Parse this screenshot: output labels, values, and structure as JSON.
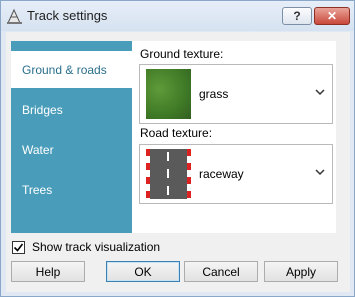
{
  "window": {
    "title": "Track settings",
    "help_button": "?",
    "close_button": "✕",
    "icon": "track-cone-icon"
  },
  "tabs": [
    {
      "label": "Ground & roads",
      "active": true
    },
    {
      "label": "Bridges",
      "active": false
    },
    {
      "label": "Water",
      "active": false
    },
    {
      "label": "Trees",
      "active": false
    }
  ],
  "ground": {
    "label": "Ground texture:",
    "value": "grass",
    "swatch": "grass-texture"
  },
  "road": {
    "label": "Road texture:",
    "value": "raceway",
    "swatch": "raceway-texture"
  },
  "visualization": {
    "label": "Show track visualization",
    "checked": true
  },
  "buttons": {
    "help": "Help",
    "ok": "OK",
    "cancel": "Cancel",
    "apply": "Apply"
  },
  "colors": {
    "tab_panel": "#4a9dba",
    "active_tab_text": "#2a6f8c",
    "close_button": "#c9483a",
    "default_button_border": "#3c7fb1"
  }
}
